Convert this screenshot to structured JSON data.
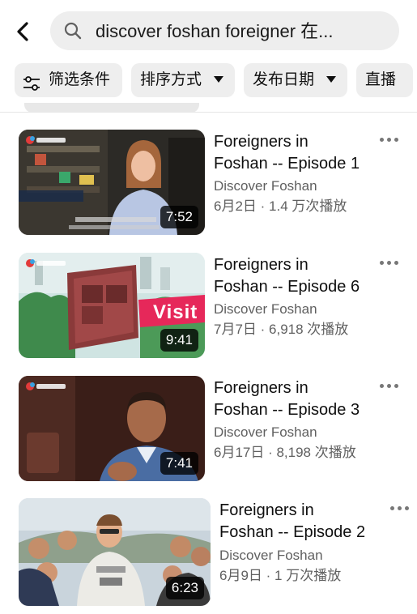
{
  "search": {
    "query": "discover foshan foreigner 在..."
  },
  "chips": [
    {
      "label": "筛选条件"
    },
    {
      "label": "排序方式"
    },
    {
      "label": "发布日期"
    },
    {
      "label": "直播"
    }
  ],
  "videos": [
    {
      "title_line1": "Foreigners in",
      "title_line2": "Foshan -- Episode 1",
      "channel": "Discover Foshan",
      "meta": "6月2日 · 1.4 万次播放",
      "duration": "7:52"
    },
    {
      "title_line1": "Foreigners in",
      "title_line2": "Foshan -- Episode 6",
      "channel": "Discover Foshan",
      "meta": "7月7日 · 6,918 次播放",
      "duration": "9:41",
      "overlay_text": "Visit"
    },
    {
      "title_line1": "Foreigners in",
      "title_line2": "Foshan -- Episode 3",
      "channel": "Discover Foshan",
      "meta": "6月17日 · 8,198 次播放",
      "duration": "7:41"
    },
    {
      "title_line1": "Foreigners in",
      "title_line2": "Foshan -- Episode 2",
      "channel": "Discover Foshan",
      "meta": "6月9日 · 1 万次播放",
      "duration": "6:23"
    }
  ],
  "colors": {
    "chip_bg": "#eeeeee",
    "search_bg": "#eeeeee",
    "secondary_text": "#606060"
  }
}
